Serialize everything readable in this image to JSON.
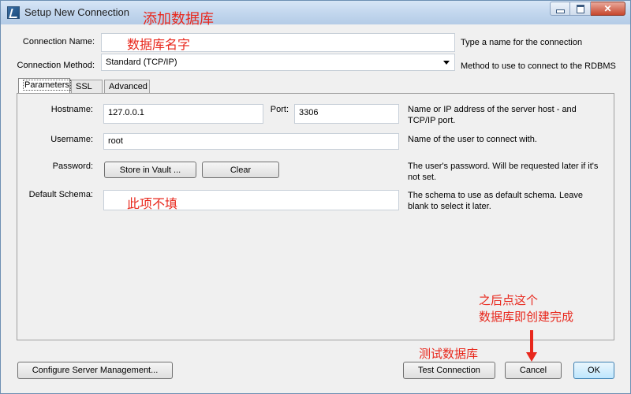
{
  "window": {
    "title": "Setup New Connection"
  },
  "annotations": {
    "title_note": "添加数据库",
    "name_note": "数据库名字",
    "schema_note": "此项不填",
    "test_note": "测试数据库",
    "finish_note_line1": "之后点这个",
    "finish_note_line2": "数据库即创建完成"
  },
  "connection": {
    "name_label": "Connection Name:",
    "name_value": "",
    "name_desc": "Type a name for the connection",
    "method_label": "Connection Method:",
    "method_value": "Standard (TCP/IP)",
    "method_desc": "Method to use to connect to the RDBMS"
  },
  "tabs": [
    {
      "label": "Parameters",
      "active": true
    },
    {
      "label": "SSL",
      "active": false
    },
    {
      "label": "Advanced",
      "active": false
    }
  ],
  "parameters": {
    "hostname_label": "Hostname:",
    "hostname_value": "127.0.0.1",
    "port_label": "Port:",
    "port_value": "3306",
    "host_desc": "Name or IP address of the server host - and TCP/IP port.",
    "username_label": "Username:",
    "username_value": "root",
    "username_desc": "Name of the user to connect with.",
    "password_label": "Password:",
    "store_vault_label": "Store in Vault ...",
    "clear_label": "Clear",
    "password_desc": "The user's password. Will be requested later if it's not set.",
    "schema_label": "Default Schema:",
    "schema_value": "",
    "schema_desc": "The schema to use as default schema. Leave blank to select it later."
  },
  "footer": {
    "configure_label": "Configure Server Management...",
    "test_label": "Test Connection",
    "cancel_label": "Cancel",
    "ok_label": "OK"
  }
}
